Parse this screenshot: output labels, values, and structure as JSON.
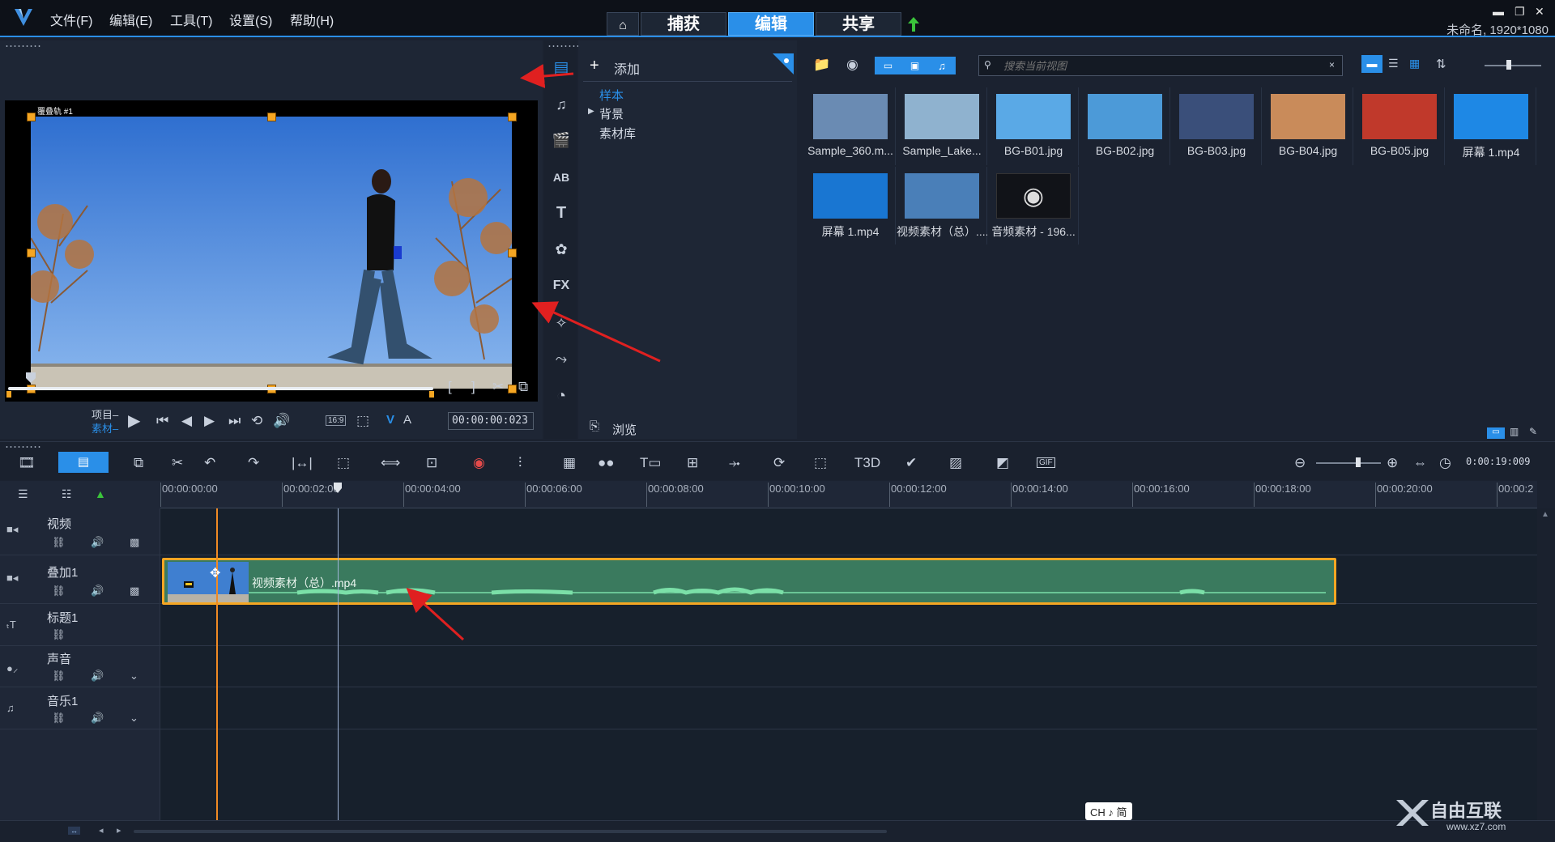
{
  "menus": [
    "文件(F)",
    "编辑(E)",
    "工具(T)",
    "设置(S)",
    "帮助(H)"
  ],
  "nav": {
    "capture": "捕获",
    "edit": "编辑",
    "share": "共享"
  },
  "project_info": "未命名, 1920*1080",
  "preview": {
    "track_label": "覆叠轨 #1",
    "project_label": "项目–",
    "clip_label": "素材–",
    "aspect": "16:9",
    "timecode": "00:00:00:023"
  },
  "library": {
    "add_label": "添加",
    "tree": [
      "样本",
      "背景",
      "素材库"
    ],
    "search_placeholder": "搜索当前视图",
    "browse_label": "浏览",
    "items": [
      {
        "caption": "Sample_360.m...",
        "color": "#6a8bb3"
      },
      {
        "caption": "Sample_Lake...",
        "color": "#8fb2cf"
      },
      {
        "caption": "BG-B01.jpg",
        "color": "#5aa9e6"
      },
      {
        "caption": "BG-B02.jpg",
        "color": "#4c9ad8"
      },
      {
        "caption": "BG-B03.jpg",
        "color": "#3a4f7a"
      },
      {
        "caption": "BG-B04.jpg",
        "color": "#c98b5a"
      },
      {
        "caption": "BG-B05.jpg",
        "color": "#c0392b"
      },
      {
        "caption": "屏幕 1.mp4",
        "color": "#1e88e5"
      },
      {
        "caption": "屏幕 1.mp4",
        "color": "#1976d2"
      },
      {
        "caption": "视频素材（总）....",
        "color": "#4a7fb8"
      },
      {
        "caption": "音频素材 - 196...",
        "color": "#111318"
      }
    ]
  },
  "timeline": {
    "zoom_time": "0:00:19:009",
    "ruler": [
      "00:00:00:00",
      "00:00:02:00",
      "00:00:04:00",
      "00:00:06:00",
      "00:00:08:00",
      "00:00:10:00",
      "00:00:12:00",
      "00:00:14:00",
      "00:00:16:00",
      "00:00:18:00",
      "00:00:20:00",
      "00:00:2"
    ],
    "tracks": [
      "视频",
      "叠加1",
      "标题1",
      "声音",
      "音乐1"
    ],
    "clip_name": "视频素材（总）.mp4"
  },
  "ime": "CH ♪ 简",
  "watermark": {
    "brand": "自由互联",
    "url": "www.xz7.com"
  },
  "colors": {
    "accent": "#2a8fe8",
    "clip": "#3a7a5e",
    "handle": "#f5a623",
    "arrow": "#e02020"
  }
}
